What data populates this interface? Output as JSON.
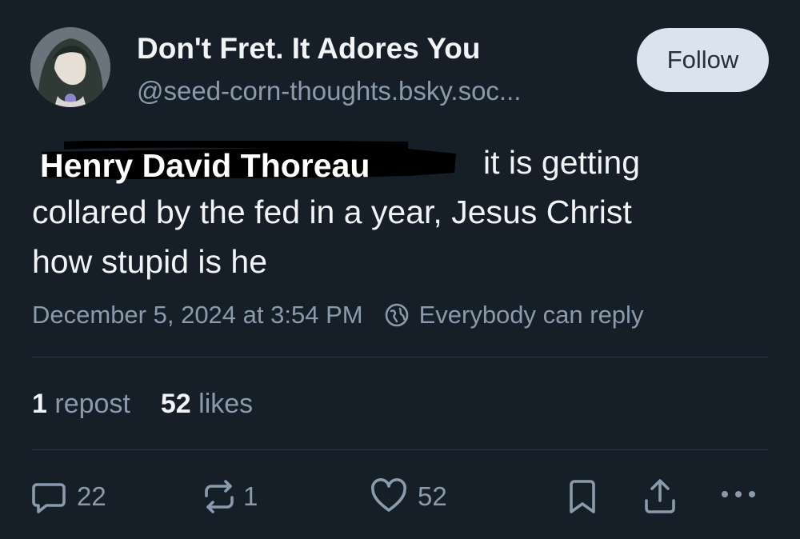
{
  "author": {
    "display_name": "Don't Fret. It Adores You",
    "handle": "@seed-corn-thoughts.bsky.soc..."
  },
  "follow_label": "Follow",
  "post": {
    "overlay_name": "Henry David Thoreau",
    "line1_visible": "it is getting",
    "line2": "collared by the fed in a year, Jesus Christ",
    "line3": "how stupid is he"
  },
  "meta": {
    "timestamp": "December 5, 2024 at 3:54 PM",
    "reply_setting": "Everybody can reply"
  },
  "stats": {
    "reposts_count": "1",
    "reposts_label": "repost",
    "likes_count": "52",
    "likes_label": "likes"
  },
  "actions": {
    "reply_count": "22",
    "repost_count": "1",
    "like_count": "52"
  },
  "colors": {
    "background": "#161e27",
    "text_primary": "#f1f3f5",
    "text_secondary": "#8a9bad",
    "follow_button": "#dbe4ee"
  },
  "icons": [
    "reply-icon",
    "repost-icon",
    "like-icon",
    "bookmark-icon",
    "share-icon",
    "more-icon",
    "globe-icon"
  ]
}
